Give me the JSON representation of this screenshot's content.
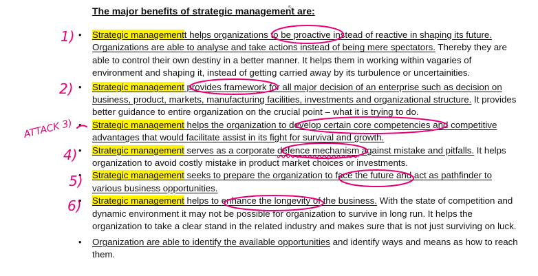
{
  "document": {
    "title": "The major benefits of strategic management are:",
    "items": [
      {
        "highlight": "Strategic management",
        "text_a": "t helps organizations ",
        "circled": "to be proactive",
        "text_b": " instead of reactive in shaping its future. Organizations are able to analyse and take actions instead of being  mere spectators.",
        "text_c": " Thereby they are able to control their own destiny in a better manner. It helps them in working within vagaries of environment and shaping it, instead of getting carried away by its turbulence or uncertainities."
      },
      {
        "highlight": "Strategic management",
        "text_a": " ",
        "circled": "provides framework",
        "text_b": " for all major decision of an enterprise such as decision on business, product, markets, manufacturing facilities, investments and organizational structure.",
        "text_c": " It provides better guidance to entire organization on the crucial point – what it is trying to do."
      },
      {
        "highlight": "Strategic management",
        "text_a": " helps the organization to ",
        "circled": "develop certain core competencies",
        "text_b": " and competitive advantages that would facilitate assist in its fight for survival and growth.",
        "text_c": ""
      },
      {
        "highlight": "Strategic management",
        "text_a": " serves as a corporate ",
        "circled": "defence mechanism",
        "text_b": " against mistake and pitfalls.",
        "text_c": " It helps organization to avoid costly mistake in product market choices or investments."
      },
      {
        "highlight": "Strategic management",
        "text_a": " seeks to prepare the organization to ",
        "circled": "face the future",
        "text_b": " and act as pathfinder to various business opportunities.",
        "text_c": ""
      },
      {
        "highlight": "Strategic management",
        "text_a": " helps to ",
        "circled": "enhance the longevity",
        "text_b": " of the business.",
        "text_c": " With the state of competition and dynamic environment it may not be possible for organization to survive in long run. It helps the organization to take a clear stand in the related industry and makes sure that is not just surviving on luck."
      },
      {
        "highlight": "",
        "text_a": "Organization are able to identify the available opportunities",
        "circled": "",
        "text_b": " and identify ways and means as how to reach them.",
        "text_c": ""
      }
    ],
    "bullet": "•"
  },
  "annotations": {
    "numbers": [
      "1)",
      "2)",
      "ATTACK 3)",
      "4)",
      "5)",
      "6)"
    ],
    "ink_color": "#e6007a",
    "highlight_color": "#fff200"
  }
}
